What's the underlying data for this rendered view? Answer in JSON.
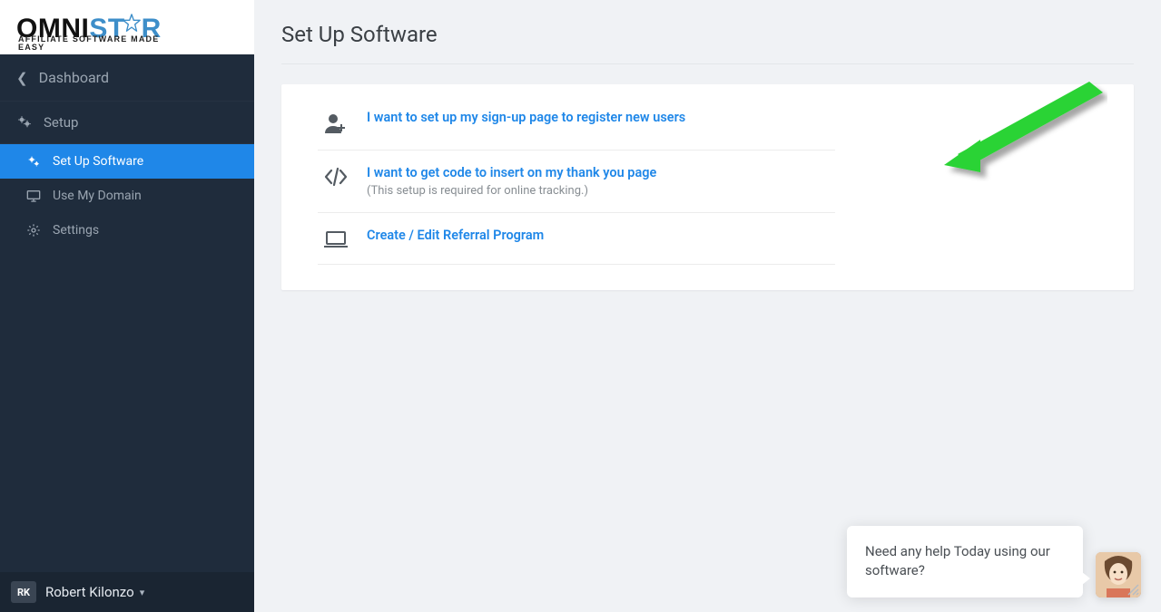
{
  "logo": {
    "part1": "OMNI",
    "part2": "ST",
    "part3": "R",
    "tagline": "AFFILIATE SOFTWARE MADE EASY"
  },
  "sidebar": {
    "back_label": "Dashboard",
    "section_label": "Setup",
    "items": [
      {
        "label": "Set Up Software",
        "icon": "gears-icon",
        "active": true
      },
      {
        "label": "Use My Domain",
        "icon": "monitor-icon",
        "active": false
      },
      {
        "label": "Settings",
        "icon": "gear-icon",
        "active": false
      }
    ]
  },
  "user": {
    "initials": "RK",
    "name": "Robert Kilonzo"
  },
  "page": {
    "title": "Set Up Software"
  },
  "options": [
    {
      "icon": "user-plus-icon",
      "link": "I want to set up my sign-up page to register new users",
      "sub": ""
    },
    {
      "icon": "code-icon",
      "link": "I want to get code to insert on my thank you page",
      "sub": "(This setup is required for online tracking.)"
    },
    {
      "icon": "laptop-icon",
      "link": "Create / Edit Referral Program",
      "sub": ""
    }
  ],
  "chat": {
    "message": "Need any help Today using our software?"
  }
}
